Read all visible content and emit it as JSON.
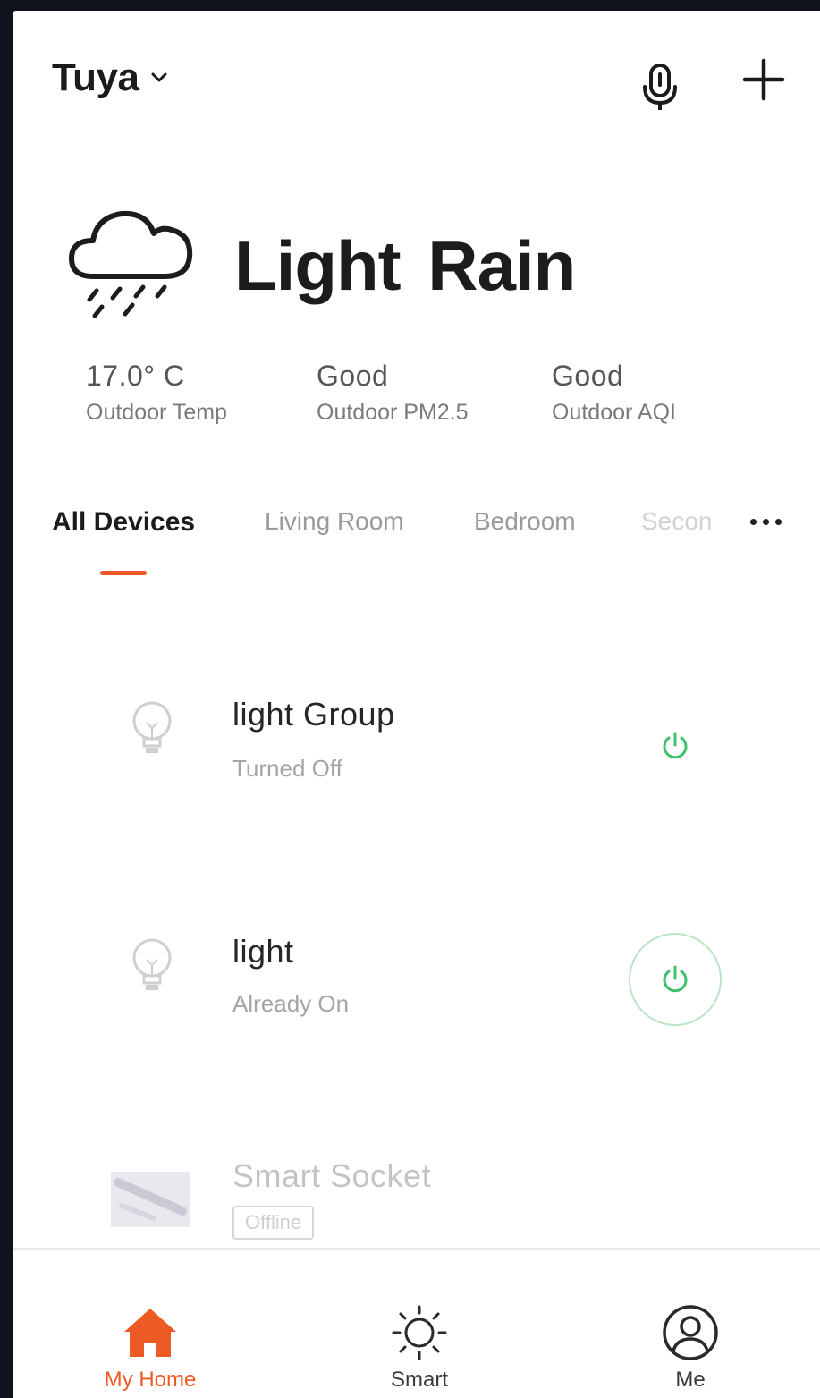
{
  "header": {
    "home_name": "Tuya",
    "icons": [
      "chevron-down-icon",
      "microphone-icon",
      "plus-icon"
    ]
  },
  "weather": {
    "icon": "rain-cloud-icon",
    "condition": "Light Rain",
    "stats": [
      {
        "value": "17.0° C",
        "label": "Outdoor Temp"
      },
      {
        "value": "Good",
        "label": "Outdoor PM2.5"
      },
      {
        "value": "Good",
        "label": "Outdoor AQI"
      }
    ]
  },
  "tabs": {
    "items": [
      "All Devices",
      "Living Room",
      "Bedroom",
      "Secon"
    ],
    "active_index": 0,
    "more_icon": "more-dots-icon",
    "accent_color": "#ee5a24"
  },
  "devices": [
    {
      "name": "light Group",
      "status": "Turned Off",
      "icon": "bulb-icon",
      "power_icon": "power-icon",
      "power_color": "#3ec26a"
    },
    {
      "name": "light",
      "status": "Already On",
      "icon": "bulb-icon",
      "power_icon": "power-icon",
      "power_color": "#3ec26a"
    },
    {
      "name": "Smart Socket",
      "status": "Offline",
      "icon": "socket-image"
    }
  ],
  "bottom_nav": {
    "items": [
      {
        "label": "My Home",
        "icon": "home-icon",
        "active": true
      },
      {
        "label": "Smart",
        "icon": "sun-icon",
        "active": false
      },
      {
        "label": "Me",
        "icon": "user-icon",
        "active": false
      }
    ],
    "active_color": "#ee5a24"
  }
}
